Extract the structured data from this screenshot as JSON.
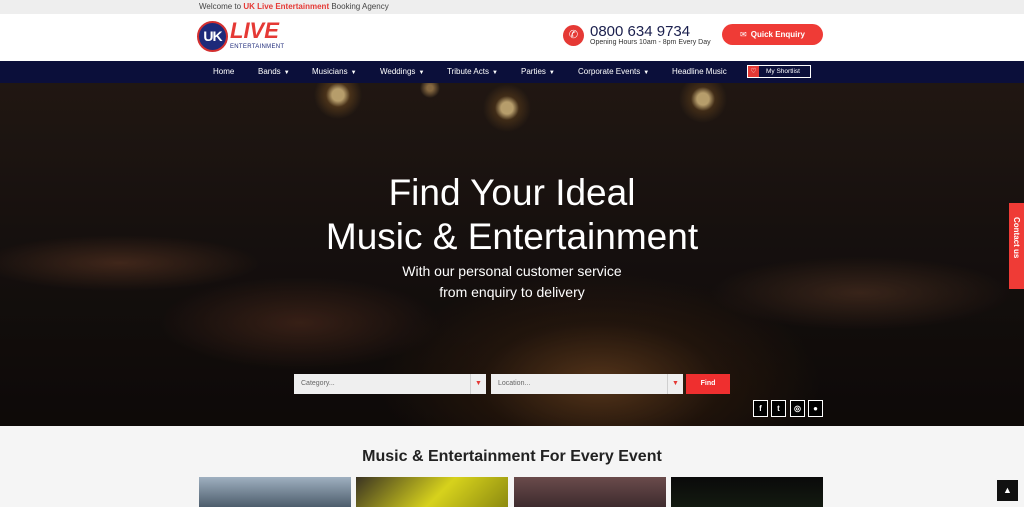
{
  "topbar": {
    "prefix": "Welcome to ",
    "brand": "UK Live Entertainment",
    "suffix": " Booking Agency"
  },
  "logo": {
    "mark": "UK",
    "word": "LIVE",
    "tagline": "ENTERTAINMENT"
  },
  "contact": {
    "phone": "0800 634 9734",
    "hours": "Opening Hours 10am - 8pm Every Day",
    "enquiry_label": "Quick Enquiry"
  },
  "nav": {
    "items": [
      {
        "label": "Home",
        "dropdown": false
      },
      {
        "label": "Bands",
        "dropdown": true
      },
      {
        "label": "Musicians",
        "dropdown": true
      },
      {
        "label": "Weddings",
        "dropdown": true
      },
      {
        "label": "Tribute Acts",
        "dropdown": true
      },
      {
        "label": "Parties",
        "dropdown": true
      },
      {
        "label": "Corporate Events",
        "dropdown": true
      },
      {
        "label": "Headline Music",
        "dropdown": false
      }
    ],
    "shortlist_label": "My Shortlist",
    "caret": "▼"
  },
  "hero": {
    "title_line1": "Find Your Ideal",
    "title_line2": "Music & Entertainment",
    "subtitle_line1": "With our personal customer service",
    "subtitle_line2": "from enquiry to delivery"
  },
  "search": {
    "category_placeholder": "Category...",
    "location_placeholder": "Location...",
    "find_label": "Find"
  },
  "social": [
    "facebook-icon",
    "twitter-icon",
    "instagram-icon",
    "chat-icon"
  ],
  "contact_tab_label": "Contact us",
  "section": {
    "title": "Music & Entertainment For Every Event"
  },
  "colors": {
    "accent": "#ef3b36",
    "nav_bg": "#0b0f3a",
    "brand_blue": "#1e2a7a"
  }
}
